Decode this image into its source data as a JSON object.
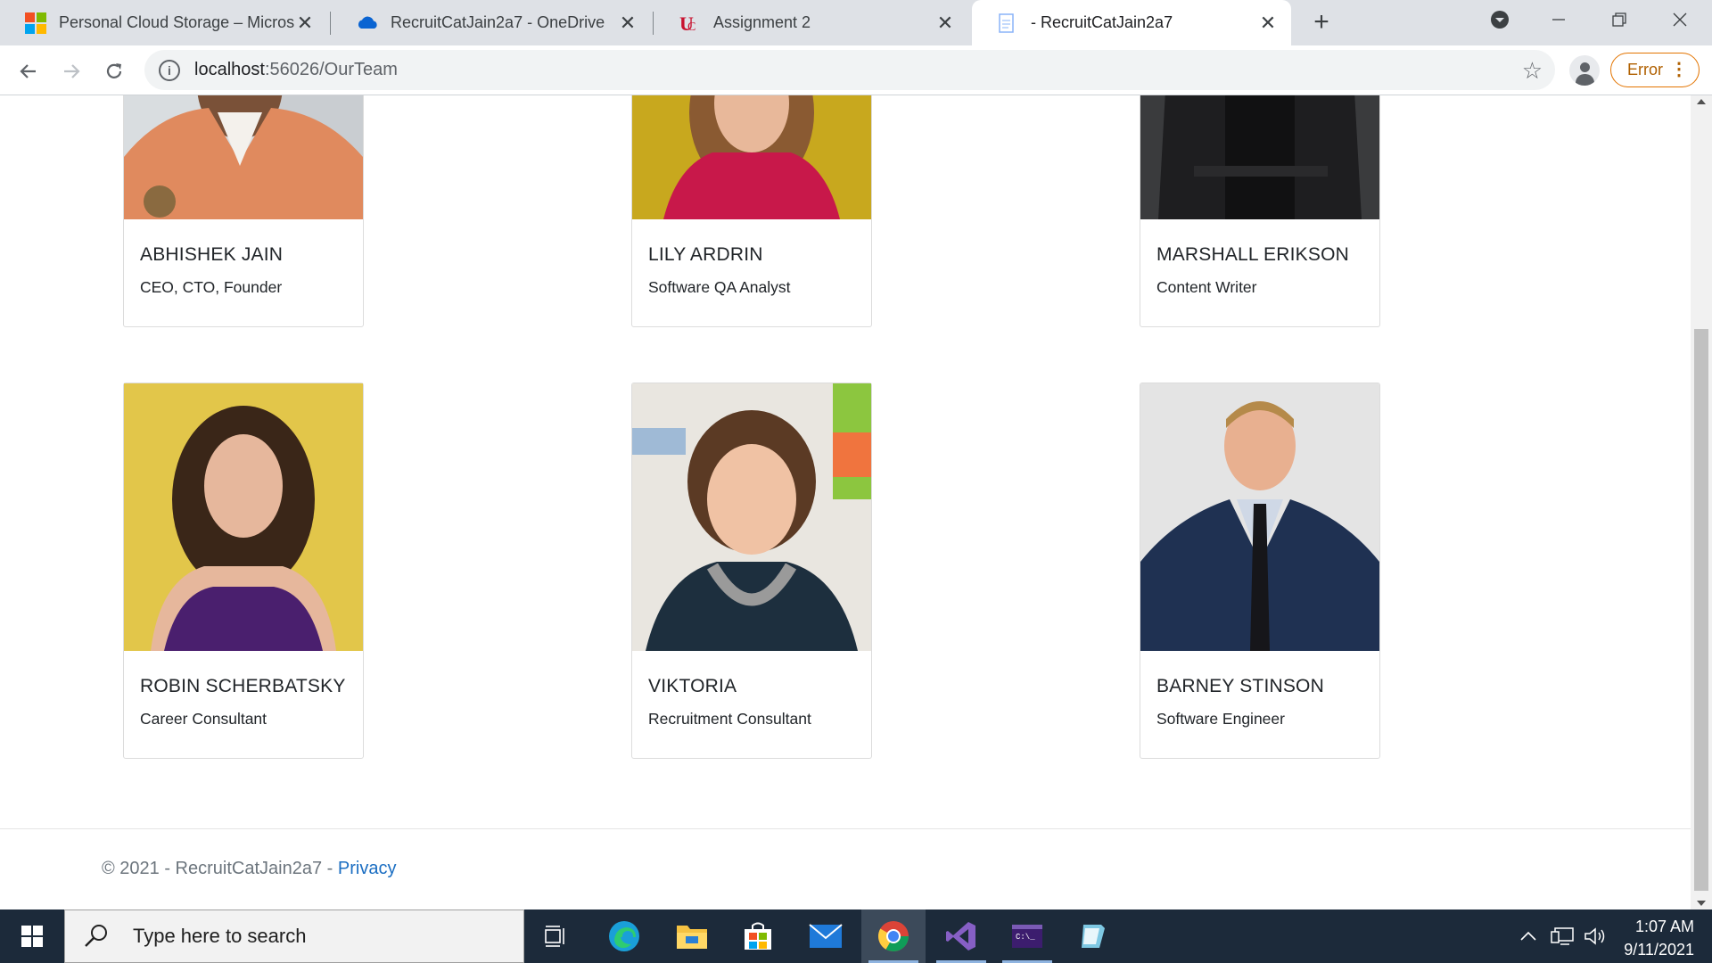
{
  "browser": {
    "tabs": [
      {
        "title": "Personal Cloud Storage – Microsoft",
        "icon": "microsoft-logo-icon"
      },
      {
        "title": "RecruitCatJain2a7 - OneDrive",
        "icon": "onedrive-icon"
      },
      {
        "title": "Assignment 2",
        "icon": "university-logo-icon"
      },
      {
        "title": "- RecruitCatJain2a7",
        "icon": "page-icon",
        "active": true
      }
    ],
    "url_host": "localhost",
    "url_path": ":56026/OurTeam",
    "error_label": "Error"
  },
  "team": [
    {
      "name": "ABHISHEK JAIN",
      "role": "CEO, CTO, Founder"
    },
    {
      "name": "LILY ARDRIN",
      "role": "Software QA Analyst"
    },
    {
      "name": "MARSHALL ERIKSON",
      "role": "Content Writer"
    },
    {
      "name": "ROBIN SCHERBATSKY",
      "role": "Career Consultant"
    },
    {
      "name": "VIKTORIA",
      "role": "Recruitment Consultant"
    },
    {
      "name": "BARNEY STINSON",
      "role": "Software Engineer"
    }
  ],
  "footer": {
    "copyright": "© 2021 - RecruitCatJain2a7 -",
    "privacy_link": "Privacy"
  },
  "taskbar": {
    "search_placeholder": "Type here to search",
    "time": "1:07 AM",
    "date": "9/11/2021"
  },
  "colors": {
    "link": "#1b6ec2",
    "taskbar": "#1c2a3a",
    "error_accent": "#e37400"
  }
}
